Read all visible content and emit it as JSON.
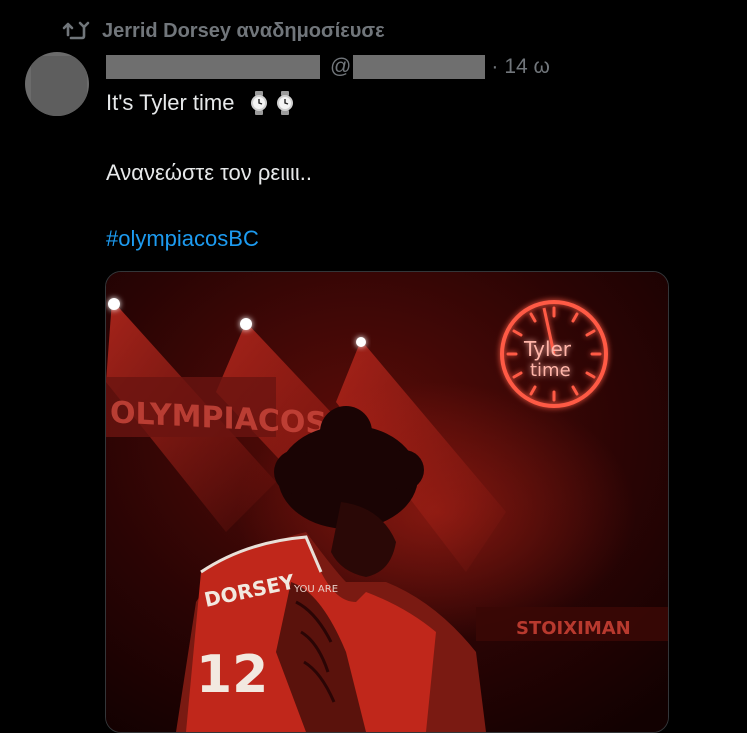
{
  "repost": {
    "label": "Jerrid Dorsey αναδημοσίευσε",
    "icon": "repost-icon"
  },
  "author": {
    "handle_prefix": "@",
    "separator": "·",
    "time": "14 ω"
  },
  "tweet": {
    "line1": "It's Tyler time",
    "line1_emoji": [
      "watch-icon",
      "watch-icon"
    ],
    "line2": "Ανανεώστε τον ρειιιι..",
    "hashtag": "#olympiacosBC"
  },
  "media": {
    "banner_text": "OLYMPIACOS",
    "clock_text_1": "Tyler",
    "clock_text_2": "time",
    "jersey_name": "DORSEY",
    "jersey_number": "12",
    "sponsor_text": "STOIXIMAN",
    "tattoo_text": "YOU ARE"
  },
  "colors": {
    "hashtag": "#1d9bf0",
    "muted": "#71767b",
    "text": "#e7e9ea",
    "neon": "#ff4a3a"
  }
}
